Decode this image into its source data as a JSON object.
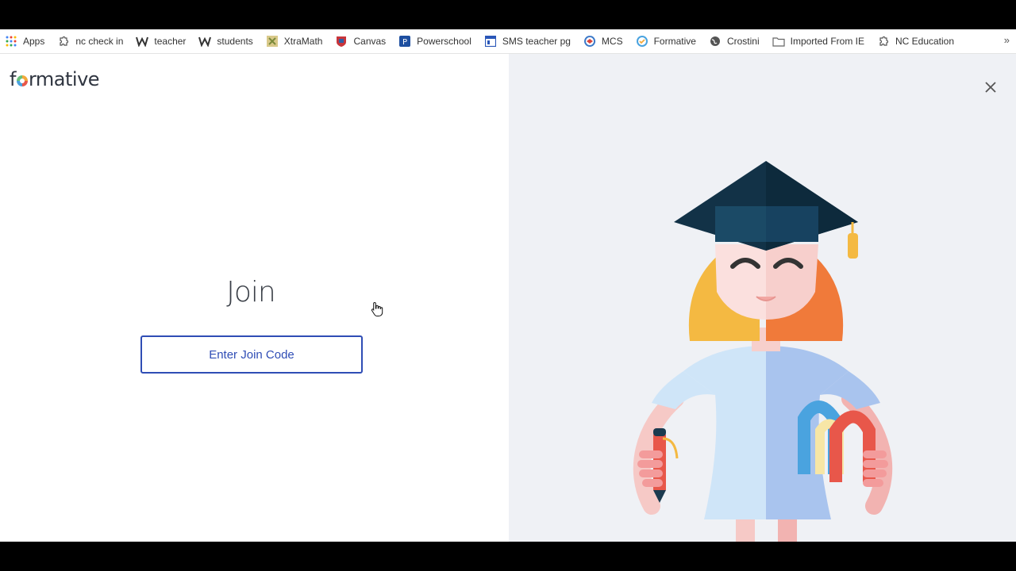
{
  "bookmarks": [
    {
      "label": "Apps",
      "icon": "apps-grid-icon"
    },
    {
      "label": "nc check in",
      "icon": "puzzle-icon"
    },
    {
      "label": "teacher",
      "icon": "weebly-w-icon"
    },
    {
      "label": "students",
      "icon": "weebly-w-icon"
    },
    {
      "label": "XtraMath",
      "icon": "xtramath-icon"
    },
    {
      "label": "Canvas",
      "icon": "canvas-icon"
    },
    {
      "label": "Powerschool",
      "icon": "powerschool-icon"
    },
    {
      "label": "SMS teacher pg",
      "icon": "sms-page-icon"
    },
    {
      "label": "MCS",
      "icon": "mcs-icon"
    },
    {
      "label": "Formative",
      "icon": "formative-icon"
    },
    {
      "label": "Crostini",
      "icon": "globe-icon"
    },
    {
      "label": "Imported From IE",
      "icon": "folder-icon"
    },
    {
      "label": "NC Education",
      "icon": "puzzle-icon"
    }
  ],
  "bookmarks_overflow": "»",
  "app": {
    "logo_text_pre": "f",
    "logo_text_post": "rmative"
  },
  "join": {
    "title": "Join",
    "button_label": "Enter Join Code"
  },
  "colors": {
    "accent": "#2f4db5",
    "right_panel_bg": "#eff1f5",
    "cap": "#0f3147",
    "hair_left": "#f4b942",
    "hair_right": "#f07a3a"
  }
}
